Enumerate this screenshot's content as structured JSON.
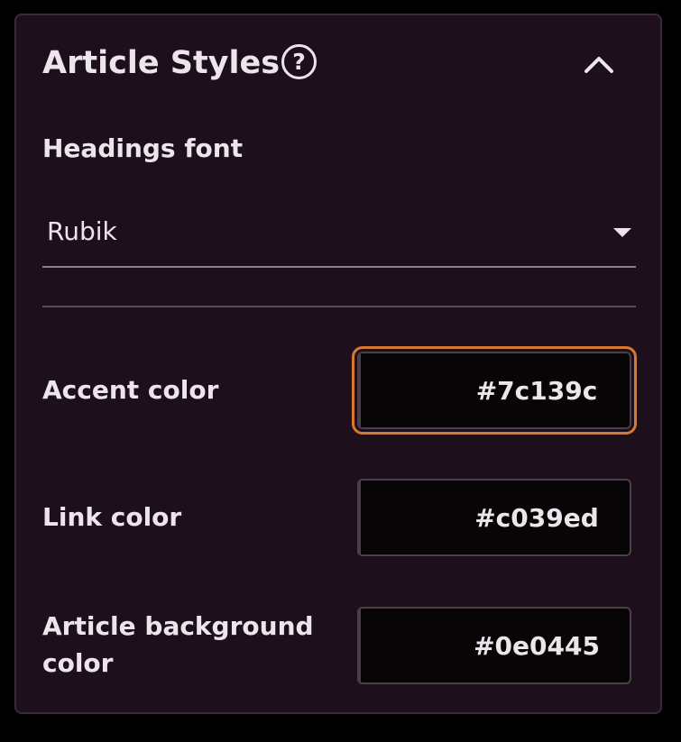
{
  "panel": {
    "title": "Article Styles",
    "help_icon": "question-circle-icon",
    "help_glyph": "?",
    "collapse_icon": "chevron-up-icon"
  },
  "headings_font": {
    "label": "Headings font",
    "value": "Rubik",
    "dropdown_icon": "caret-down-icon"
  },
  "colors": [
    {
      "label": "Accent color",
      "hex": "#7c139c",
      "swatch": "#7c139c",
      "focused": true
    },
    {
      "label": "Link color",
      "hex": "#c039ed",
      "swatch": "#c039ed",
      "focused": false
    },
    {
      "label": "Article background color",
      "hex": "#0e0445",
      "swatch": "#0e0445",
      "focused": false
    }
  ],
  "theme": {
    "panel_background": "#1e0f1d",
    "text": "#ece6ec",
    "focus_outline": "#d57a2e"
  }
}
